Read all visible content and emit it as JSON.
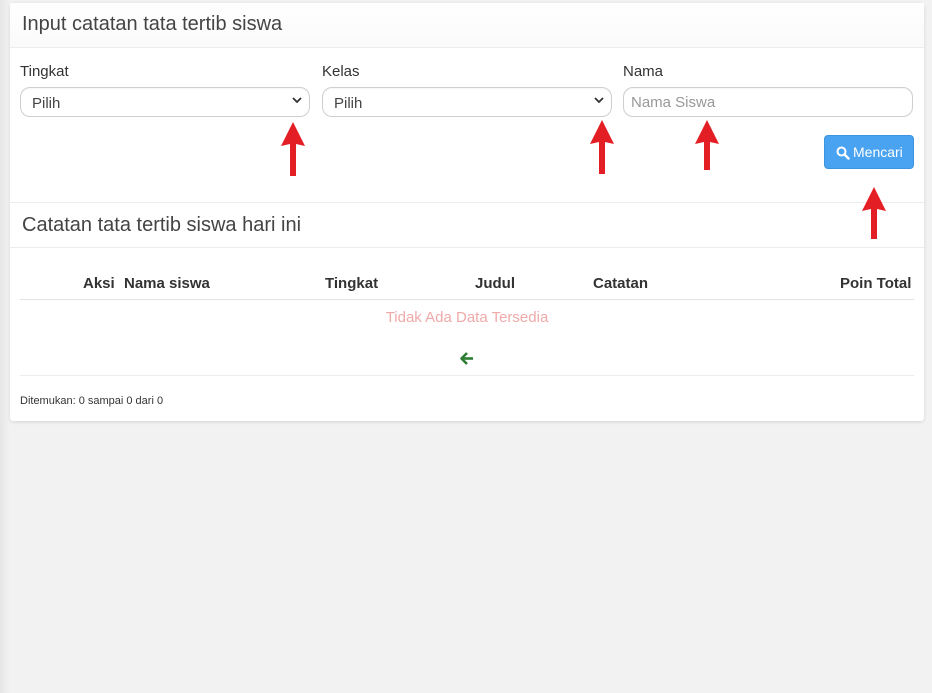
{
  "form": {
    "title": "Input catatan tata tertib siswa",
    "tingkat": {
      "label": "Tingkat",
      "value": "Pilih"
    },
    "kelas": {
      "label": "Kelas",
      "value": "Pilih"
    },
    "nama": {
      "label": "Nama",
      "placeholder": "Nama Siswa",
      "value": ""
    },
    "search_button": "Mencari"
  },
  "records": {
    "title": "Catatan tata tertib siswa hari ini",
    "columns": [
      "Aksi",
      "Nama siswa",
      "Tingkat",
      "Judul",
      "Catatan",
      "Poin Total"
    ],
    "empty_message": "Tidak Ada Data Tersedia",
    "footer_text": "Ditemukan: 0 sampai 0 dari 0"
  },
  "colors": {
    "accent": "#4aa3f0",
    "annotation_arrow": "#e31e24",
    "empty_text": "#f0a9a9",
    "back_arrow": "#2e7d32"
  },
  "icons": {
    "search": "search-icon",
    "back": "arrow-left-icon",
    "dropdown": "chevron-down-icon"
  }
}
